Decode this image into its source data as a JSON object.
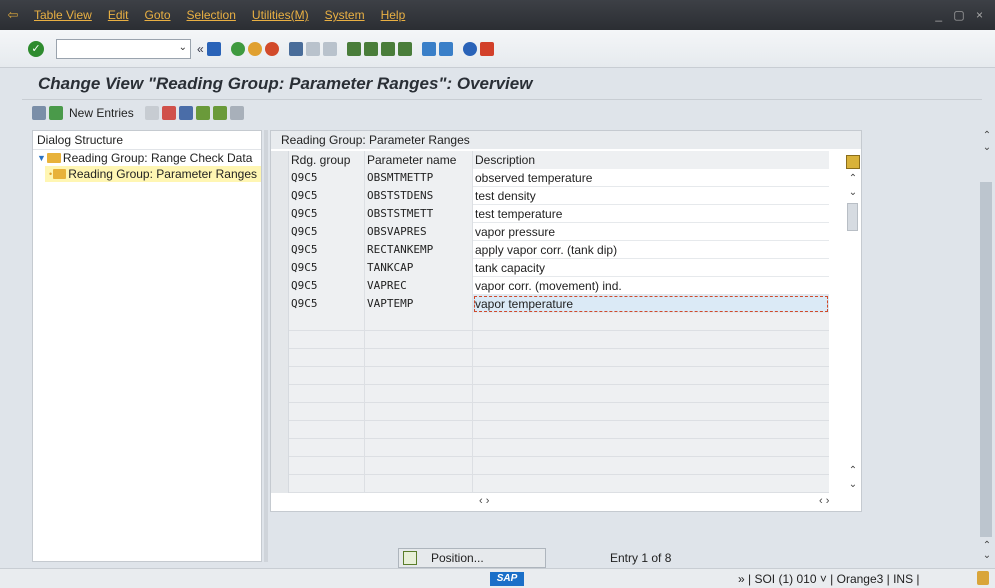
{
  "menu": [
    "Table View",
    "Edit",
    "Goto",
    "Selection",
    "Utilities(M)",
    "System",
    "Help"
  ],
  "window_controls": "_ ▢ ×",
  "command_field": {
    "value": ""
  },
  "title": "Change View \"Reading Group: Parameter Ranges\": Overview",
  "app_toolbar": {
    "new_entries": "New Entries"
  },
  "tree": {
    "header": "Dialog Structure",
    "nodes": [
      "Reading Group: Range Check Data",
      "Reading Group: Parameter Ranges"
    ]
  },
  "table": {
    "caption": "Reading Group: Parameter Ranges",
    "columns": [
      "Rdg. group",
      "Parameter name",
      "Description"
    ],
    "rows": [
      [
        "Q9C5",
        "OBSMTMETTP",
        "observed temperature"
      ],
      [
        "Q9C5",
        "OBSTSTDENS",
        "test density"
      ],
      [
        "Q9C5",
        "OBSTSTMETT",
        "test temperature"
      ],
      [
        "Q9C5",
        "OBSVAPRES",
        "vapor pressure"
      ],
      [
        "Q9C5",
        "RECTANKEMP",
        "apply vapor corr. (tank dip)"
      ],
      [
        "Q9C5",
        "TANKCAP",
        "tank capacity"
      ],
      [
        "Q9C5",
        "VAPREC",
        "vapor corr. (movement) ind."
      ],
      [
        "Q9C5",
        "VAPTEMP",
        "vapor temperature"
      ]
    ]
  },
  "position_button": "Position...",
  "entry_info": "Entry 1 of 8",
  "status": {
    "system": "» | SOI (1) 010 ˅ | Orange3 | INS |",
    "logo": "SAP"
  }
}
